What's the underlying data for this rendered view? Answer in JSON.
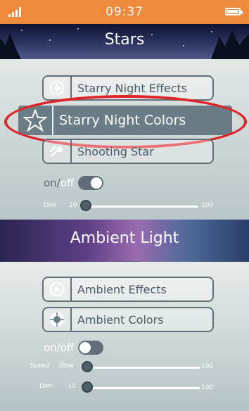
{
  "status_bar": {
    "time": "09:37",
    "signal_icon": "signal-bars-icon",
    "battery_icon": "battery-icon"
  },
  "stars_section": {
    "title": "Stars",
    "buttons": [
      {
        "label": "Starry Night Effects",
        "icon": "compass-star-icon"
      },
      {
        "label": "Starry Night Colors",
        "icon": "star-icon",
        "selected": true
      },
      {
        "label": "Shooting Star",
        "icon": "shooting-star-icon"
      }
    ],
    "toggle": {
      "on_label": "on/",
      "off_label": "off",
      "state": "on"
    },
    "dim_slider": {
      "caption": "Dim",
      "min": "10",
      "max": "100",
      "value": 10
    }
  },
  "ambient_section": {
    "title": "Ambient Light",
    "buttons": [
      {
        "label": "Ambient Effects",
        "icon": "play-circle-icon"
      },
      {
        "label": "Ambient Colors",
        "icon": "color-wheel-icon"
      }
    ],
    "toggle": {
      "label": "on/off",
      "state": "off"
    },
    "speed_slider": {
      "caption": "Speed",
      "min": "Slow",
      "max": "100",
      "value": 0
    },
    "dim_slider": {
      "caption": "Dim",
      "min": "10",
      "max": "100",
      "value": 10
    }
  },
  "colors": {
    "status_bar": "#ef8a3c",
    "selected_button": "#6a7d86",
    "highlight": "#e0252a",
    "toggle_on": "#5f6e78",
    "toggle_off": "#5f6e78"
  }
}
